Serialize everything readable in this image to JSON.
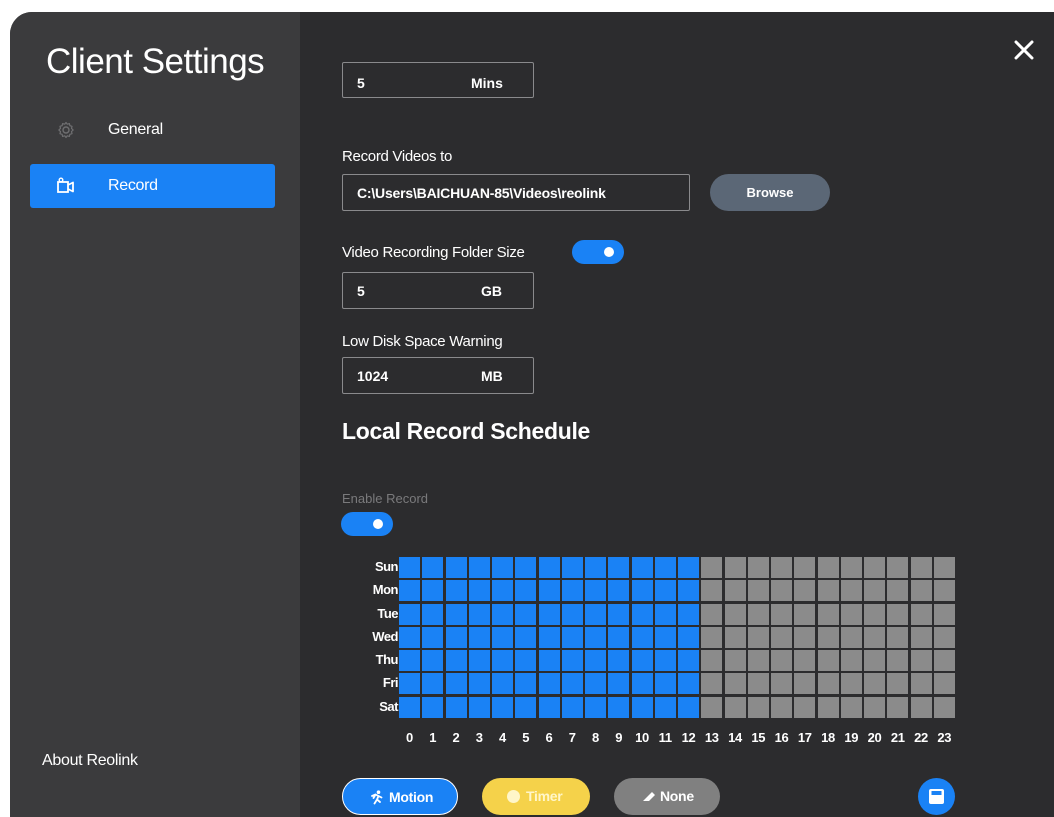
{
  "sidebar": {
    "title": "Client Settings",
    "items": [
      {
        "label": "General",
        "icon": "gear-icon",
        "active": false
      },
      {
        "label": "Record",
        "icon": "video-camera-icon",
        "active": true
      }
    ],
    "about": "About Reolink"
  },
  "main": {
    "duration": {
      "value": "5",
      "unit": "Mins"
    },
    "record_path": {
      "label": "Record Videos to",
      "value": "C:\\Users\\BAICHUAN-85\\Videos\\reolink",
      "browse_label": "Browse"
    },
    "folder_size": {
      "label": "Video Recording Folder Size",
      "enabled": true,
      "value": "5",
      "unit": "GB"
    },
    "low_disk": {
      "label": "Low Disk Space Warning",
      "value": "1024",
      "unit": "MB"
    },
    "schedule": {
      "title": "Local Record Schedule",
      "enable_label": "Enable Record",
      "enabled": true,
      "days": [
        "Sun",
        "Mon",
        "Tue",
        "Wed",
        "Thu",
        "Fri",
        "Sat"
      ],
      "hours": [
        "0",
        "1",
        "2",
        "3",
        "4",
        "5",
        "6",
        "7",
        "8",
        "9",
        "10",
        "11",
        "12",
        "13",
        "14",
        "15",
        "16",
        "17",
        "18",
        "19",
        "20",
        "21",
        "22",
        "23"
      ],
      "active_hours_per_day": 13
    },
    "legend": {
      "motion": "Motion",
      "timer": "Timer",
      "none": "None"
    }
  },
  "colors": {
    "accent": "#1a82f5",
    "timer": "#f5d24a",
    "none": "#808080",
    "inactive_cell": "#8b8b8b"
  }
}
